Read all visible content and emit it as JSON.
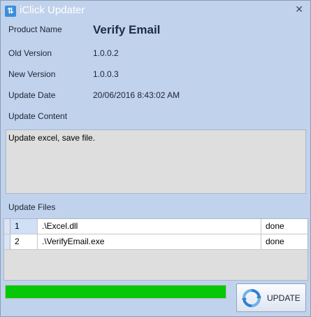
{
  "window": {
    "title": "iClick Updater",
    "app_icon": "updater-app-icon",
    "close_glyph": "✕"
  },
  "fields": {
    "product_name_label": "Product Name",
    "product_name": "Verify Email",
    "old_version_label": "Old Version",
    "old_version": "1.0.0.2",
    "new_version_label": "New Version",
    "new_version": "1.0.0.3",
    "update_date_label": "Update Date",
    "update_date": "20/06/2016 8:43:02 AM",
    "update_content_label": "Update Content",
    "update_content": "Update excel, save file.",
    "update_files_label": "Update Files"
  },
  "files": [
    {
      "index": "1",
      "path": ".\\Excel.dll",
      "status": "done"
    },
    {
      "index": "2",
      "path": ".\\VerifyEmail.exe",
      "status": "done"
    }
  ],
  "progress": {
    "fraction": 1.0,
    "color": "#06c806"
  },
  "update_button": {
    "label": "UPDATE",
    "icon": "refresh-icon"
  },
  "colors": {
    "window_bg": "#c1d2ec",
    "accent": "#3a8edb"
  }
}
